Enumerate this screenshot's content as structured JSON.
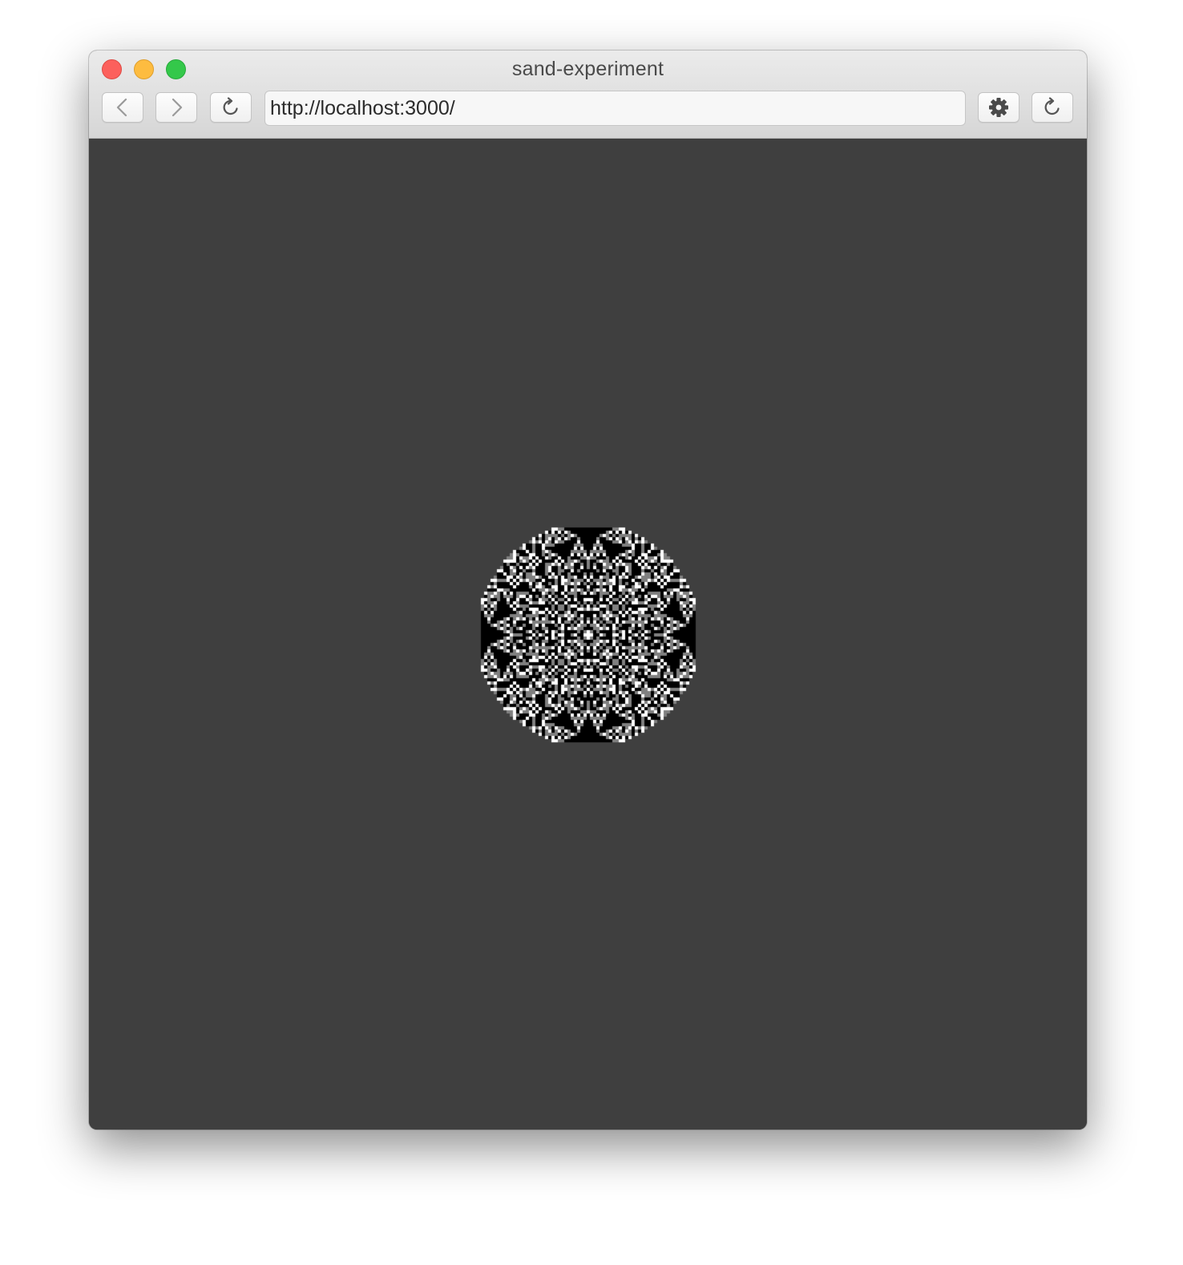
{
  "window": {
    "title": "sand-experiment"
  },
  "toolbar": {
    "url": "http://localhost:3000/"
  },
  "icons": {
    "back": "chevron-left-icon",
    "forward": "chevron-right-icon",
    "reload": "reload-icon",
    "settings": "gear-icon",
    "reload_right": "reload-icon"
  },
  "colors": {
    "page_background": "#3f3f3f",
    "canvas_background": "#ffffff",
    "pattern_ink": "#000000",
    "pattern_mid": "#808080"
  }
}
